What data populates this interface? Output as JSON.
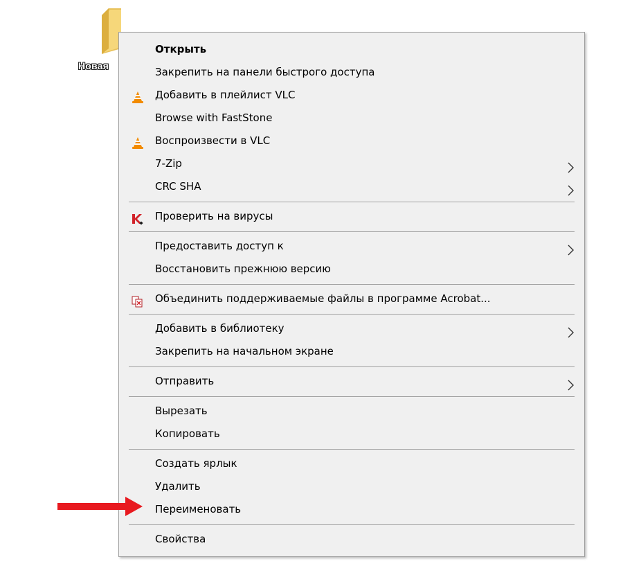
{
  "desktop": {
    "folder_label": "Новая"
  },
  "menu": {
    "items": [
      {
        "label": "Открыть",
        "bold": true,
        "icon": null,
        "submenu": false
      },
      {
        "label": "Закрепить на панели быстрого доступа",
        "icon": null,
        "submenu": false
      },
      {
        "label": "Добавить в плейлист VLC",
        "icon": "vlc-cone-icon",
        "submenu": false
      },
      {
        "label": "Browse with FastStone",
        "icon": null,
        "submenu": false
      },
      {
        "label": "Воспроизвести в VLC",
        "icon": "vlc-cone-icon",
        "submenu": false
      },
      {
        "label": "7-Zip",
        "icon": null,
        "submenu": true
      },
      {
        "label": "CRC SHA",
        "icon": null,
        "submenu": true
      },
      {
        "label": "Проверить на вирусы",
        "icon": "kaspersky-icon",
        "submenu": false
      },
      {
        "label": "Предоставить доступ к",
        "icon": null,
        "submenu": true
      },
      {
        "label": "Восстановить прежнюю версию",
        "icon": null,
        "submenu": false
      },
      {
        "label": "Объединить поддерживаемые файлы в программе Acrobat...",
        "icon": "acrobat-combine-icon",
        "submenu": false
      },
      {
        "label": "Добавить в библиотеку",
        "icon": null,
        "submenu": true
      },
      {
        "label": "Закрепить на начальном экране",
        "icon": null,
        "submenu": false
      },
      {
        "label": "Отправить",
        "icon": null,
        "submenu": true
      },
      {
        "label": "Вырезать",
        "icon": null,
        "submenu": false
      },
      {
        "label": "Копировать",
        "icon": null,
        "submenu": false
      },
      {
        "label": "Создать ярлык",
        "icon": null,
        "submenu": false
      },
      {
        "label": "Удалить",
        "icon": null,
        "submenu": false
      },
      {
        "label": "Переименовать",
        "icon": null,
        "submenu": false,
        "highlighted_by_arrow": true
      },
      {
        "label": "Свойства",
        "icon": null,
        "submenu": false
      }
    ]
  },
  "colors": {
    "menu_background": "#f0f0f0",
    "separator": "#a0a0a0",
    "annotation_arrow": "#e8191f",
    "vlc_orange": "#f28b00",
    "kaspersky_red": "#d2232a"
  }
}
